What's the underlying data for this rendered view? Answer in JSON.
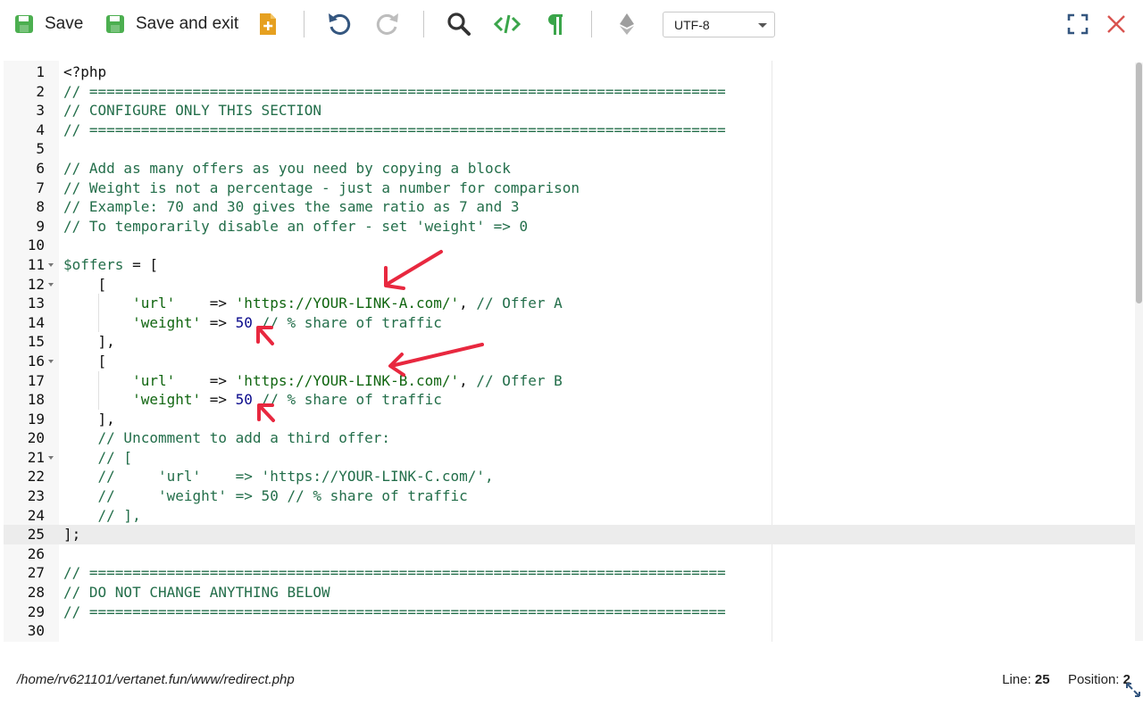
{
  "toolbar": {
    "save_label": "Save",
    "save_exit_label": "Save and exit",
    "encoding": "UTF-8",
    "icons": [
      "save-icon",
      "save-exit-icon",
      "new-file-icon",
      "undo-icon",
      "redo-icon",
      "search-icon",
      "code-icon",
      "paragraph-icon",
      "ethereum-icon",
      "fullscreen-icon",
      "close-icon"
    ]
  },
  "colors": {
    "green": "#4caf50",
    "blue": "#34567f",
    "orange": "#e6a020",
    "gray": "#9e9e9e",
    "close": "#d9534f",
    "comment": "#236e4a",
    "string": "#116611",
    "number": "#0a0a8c",
    "arrow": "#e8283f"
  },
  "editor": {
    "active_line": 25,
    "lines": [
      {
        "n": "1",
        "t": "<?php"
      },
      {
        "n": "2",
        "t": "// =========================================================================="
      },
      {
        "n": "3",
        "t": "// CONFIGURE ONLY THIS SECTION"
      },
      {
        "n": "4",
        "t": "// =========================================================================="
      },
      {
        "n": "5",
        "t": ""
      },
      {
        "n": "6",
        "t": "// Add as many offers as you need by copying a block"
      },
      {
        "n": "7",
        "t": "// Weight is not a percentage - just a number for comparison"
      },
      {
        "n": "8",
        "t": "// Example: 70 and 30 gives the same ratio as 7 and 3"
      },
      {
        "n": "9",
        "t": "// To temporarily disable an offer - set 'weight' => 0"
      },
      {
        "n": "10",
        "t": ""
      },
      {
        "n": "11",
        "t": "$offers = ["
      },
      {
        "n": "12",
        "t": "    ["
      },
      {
        "n": "13",
        "t": "        'url'    => 'https://YOUR-LINK-A.com/', // Offer A"
      },
      {
        "n": "14",
        "t": "        'weight' => 50 // % share of traffic"
      },
      {
        "n": "15",
        "t": "    ],"
      },
      {
        "n": "16",
        "t": "    ["
      },
      {
        "n": "17",
        "t": "        'url'    => 'https://YOUR-LINK-B.com/', // Offer B"
      },
      {
        "n": "18",
        "t": "        'weight' => 50 // % share of traffic"
      },
      {
        "n": "19",
        "t": "    ],"
      },
      {
        "n": "20",
        "t": "    // Uncomment to add a third offer:"
      },
      {
        "n": "21",
        "t": "    // ["
      },
      {
        "n": "22",
        "t": "    //     'url'    => 'https://YOUR-LINK-C.com/',"
      },
      {
        "n": "23",
        "t": "    //     'weight' => 50 // % share of traffic"
      },
      {
        "n": "24",
        "t": "    // ],"
      },
      {
        "n": "25",
        "t": "];"
      },
      {
        "n": "26",
        "t": ""
      },
      {
        "n": "27",
        "t": "// =========================================================================="
      },
      {
        "n": "28",
        "t": "// DO NOT CHANGE ANYTHING BELOW"
      },
      {
        "n": "29",
        "t": "// =========================================================================="
      },
      {
        "n": "30",
        "t": ""
      }
    ]
  },
  "status": {
    "path": "/home/rv621101/vertanet.fun/www/redirect.php",
    "line_label": "Line:",
    "line_value": "25",
    "position_label": "Position:",
    "position_value": "2"
  }
}
